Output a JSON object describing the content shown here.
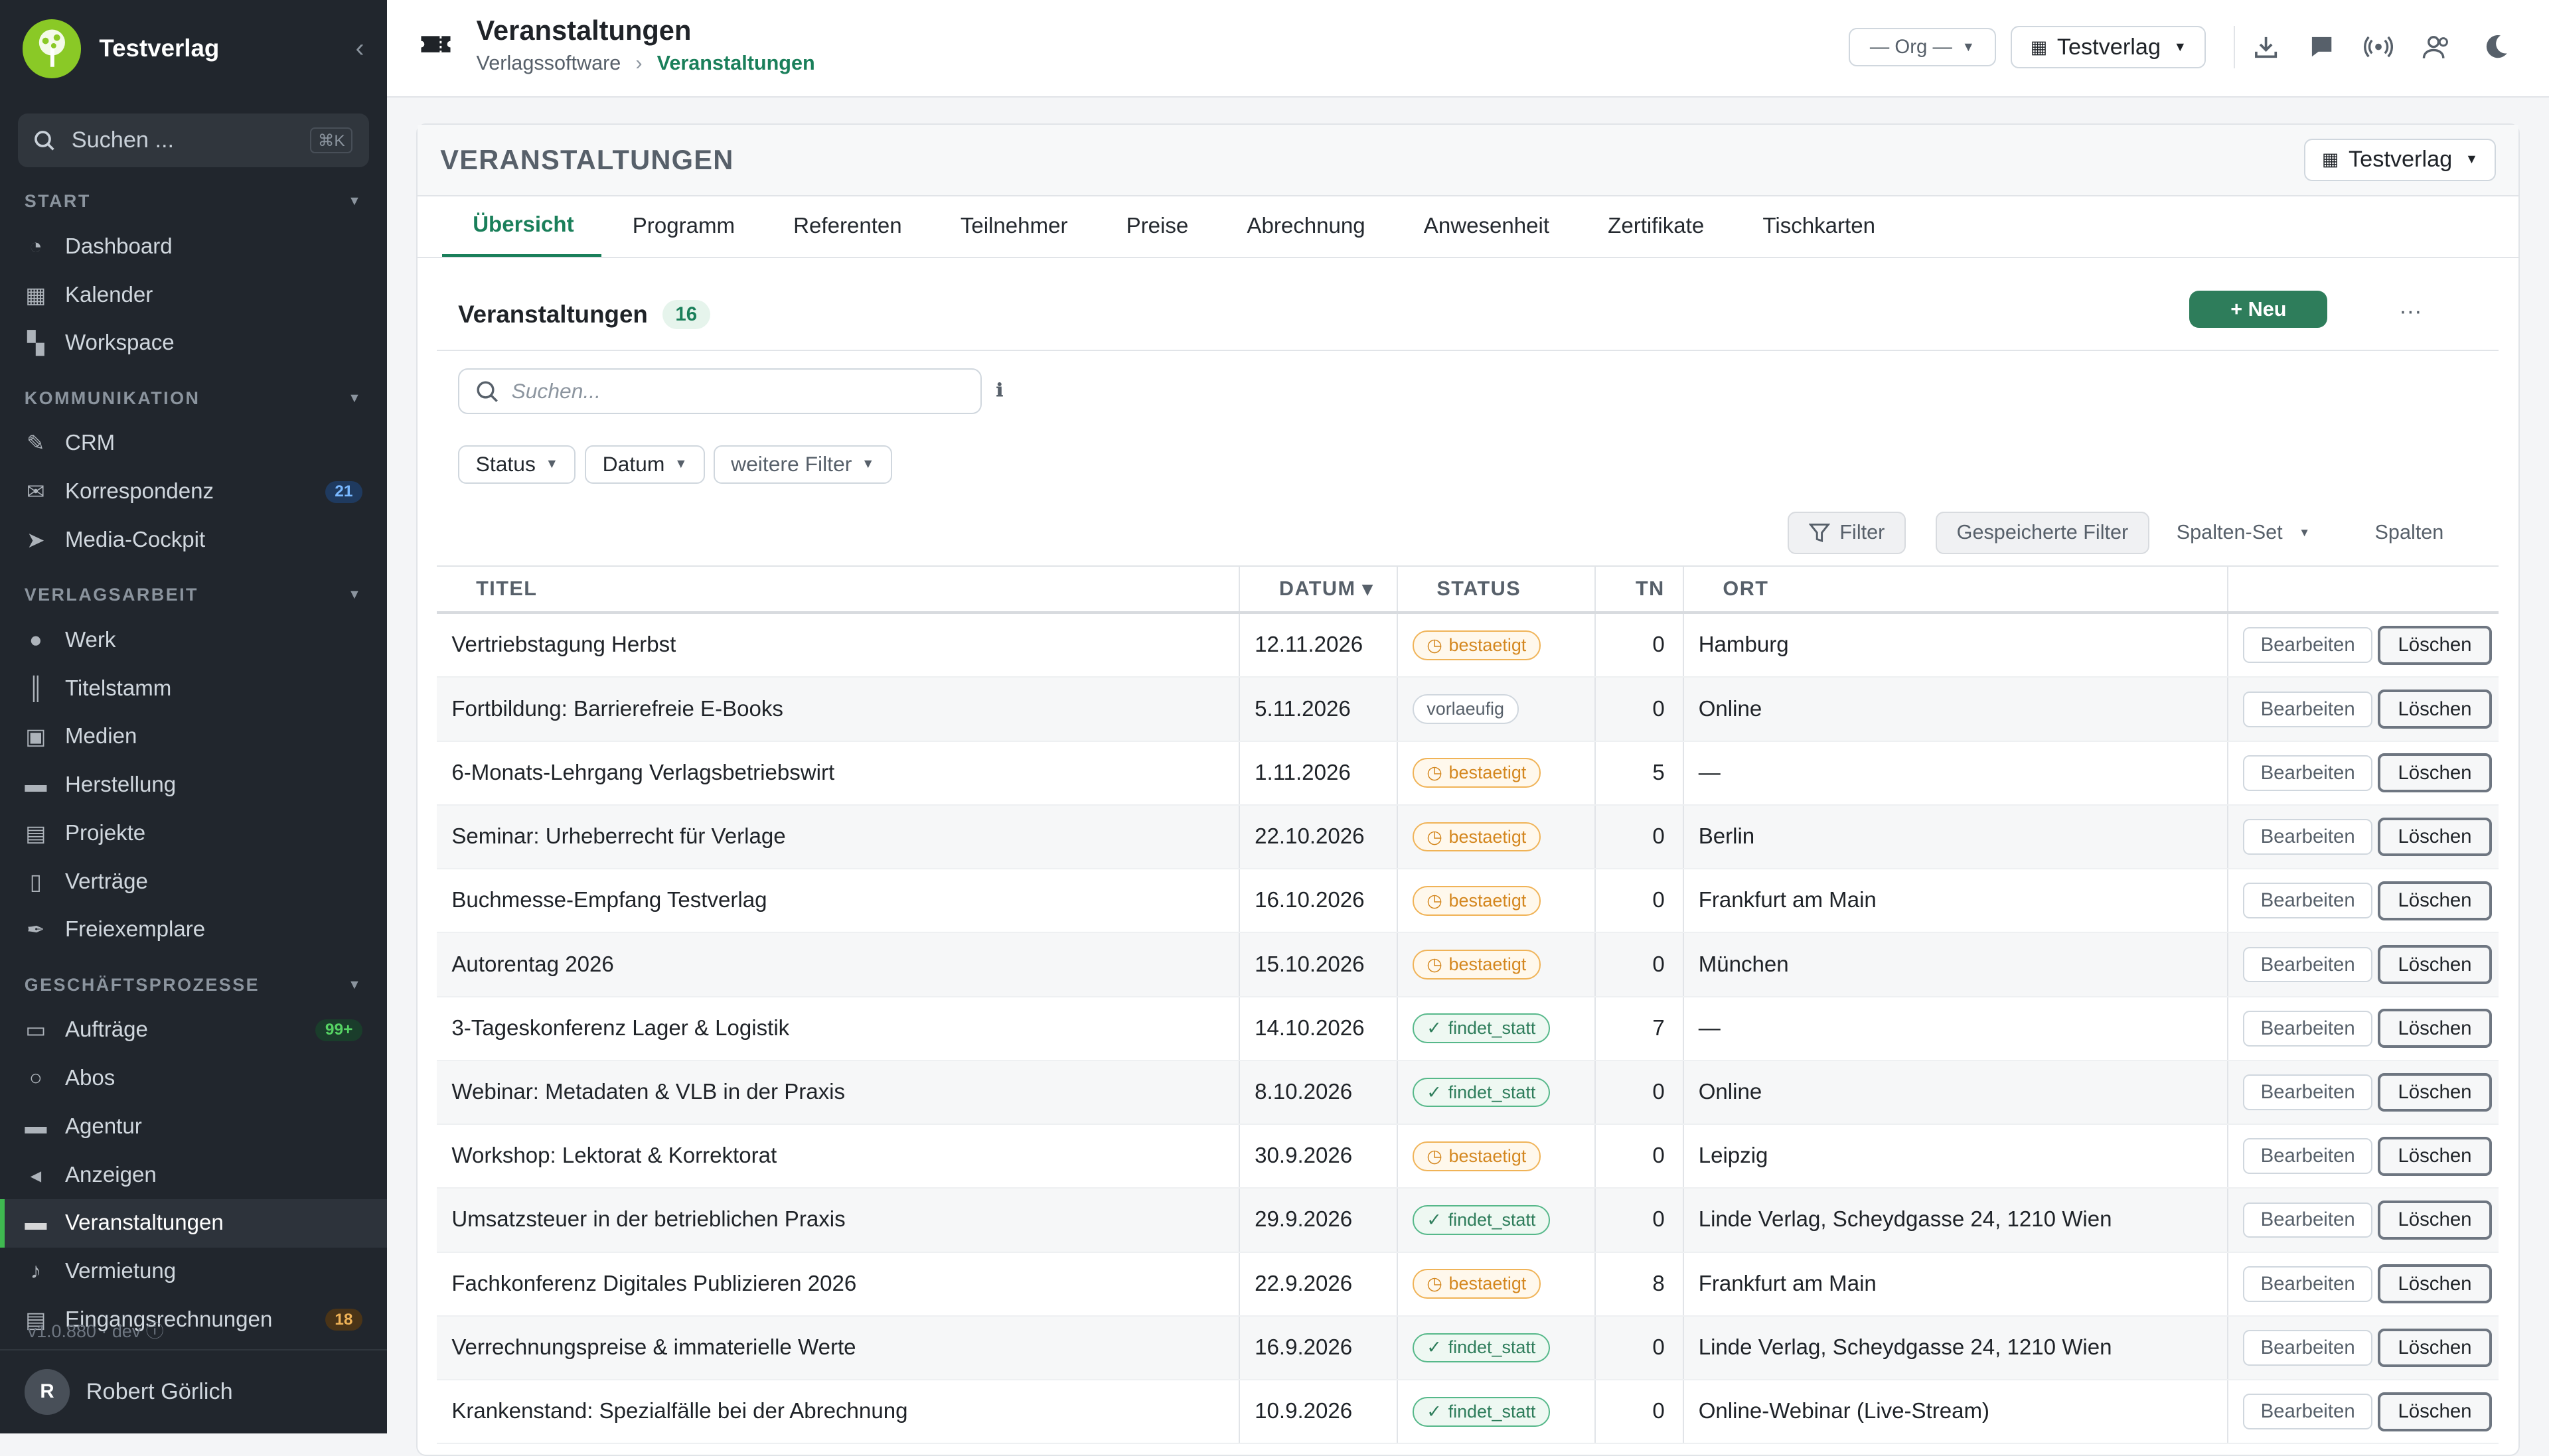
{
  "sidebar": {
    "brand": "Testverlag",
    "search_placeholder": "Suchen ...",
    "search_shortcut": "⌘K",
    "sections": [
      {
        "label": "START",
        "items": [
          {
            "label": "Dashboard",
            "icon": "dashboard-icon"
          },
          {
            "label": "Kalender",
            "icon": "calendar-icon"
          },
          {
            "label": "Workspace",
            "icon": "workspace-icon"
          }
        ]
      },
      {
        "label": "KOMMUNIKATION",
        "items": [
          {
            "label": "CRM",
            "icon": "crm-icon"
          },
          {
            "label": "Korrespondenz",
            "icon": "mail-icon",
            "badge": "21"
          },
          {
            "label": "Media-Cockpit",
            "icon": "send-icon"
          }
        ]
      },
      {
        "label": "VERLAGSARBEIT",
        "items": [
          {
            "label": "Werk",
            "icon": "bulb-icon"
          },
          {
            "label": "Titelstamm",
            "icon": "books-icon"
          },
          {
            "label": "Medien",
            "icon": "image-icon"
          },
          {
            "label": "Herstellung",
            "icon": "briefcase-icon"
          },
          {
            "label": "Projekte",
            "icon": "project-icon"
          },
          {
            "label": "Verträge",
            "icon": "contract-icon"
          },
          {
            "label": "Freiexemplare",
            "icon": "feather-icon"
          }
        ]
      },
      {
        "label": "GESCHÄFTSPROZESSE",
        "items": [
          {
            "label": "Aufträge",
            "icon": "orders-icon",
            "badge": "99+"
          },
          {
            "label": "Abos",
            "icon": "subscription-icon"
          },
          {
            "label": "Agentur",
            "icon": "agency-icon"
          },
          {
            "label": "Anzeigen",
            "icon": "megaphone-icon"
          },
          {
            "label": "Veranstaltungen",
            "icon": "ticket-icon"
          },
          {
            "label": "Vermietung",
            "icon": "note-icon"
          },
          {
            "label": "Eingangsrechnungen",
            "icon": "invoice-icon",
            "badge": "18"
          }
        ]
      }
    ],
    "version": "v1.0.880 · dev",
    "user": {
      "initial": "R",
      "name": "Robert Görlich"
    }
  },
  "header": {
    "title": "Veranstaltungen",
    "breadcrumb": [
      "Verlagssoftware",
      "Veranstaltungen"
    ],
    "org_select": "— Org —",
    "verlag_select": "Testverlag"
  },
  "card": {
    "title": "VERANSTALTUNGEN",
    "verlag_select": "Testverlag",
    "tabs": [
      "Übersicht",
      "Programm",
      "Referenten",
      "Teilnehmer",
      "Preise",
      "Abrechnung",
      "Anwesenheit",
      "Zertifikate",
      "Tischkarten"
    ],
    "list_title": "Veranstaltungen",
    "count": "16",
    "new_button": "+ Neu",
    "more": "···",
    "search_placeholder": "Suchen...",
    "info": "ℹ",
    "filters": [
      "Status",
      "Datum",
      "weitere Filter"
    ],
    "tools": {
      "filter": "Filter",
      "saved": "Gespeicherte Filter",
      "column_set": "Spalten-Set",
      "columns": "Spalten"
    }
  },
  "table": {
    "columns": [
      "TITEL",
      "DATUM ▾",
      "STATUS",
      "TN",
      "ORT"
    ],
    "edit_label": "Bearbeiten",
    "delete_label": "Löschen",
    "rows": [
      {
        "title": "Vertriebstagung Herbst",
        "date": "12.11.2026",
        "status": "bestaetigt",
        "tn": "0",
        "ort": "Hamburg"
      },
      {
        "title": "Fortbildung: Barrierefreie E-Books",
        "date": "5.11.2026",
        "status": "vorlaeufig",
        "tn": "0",
        "ort": "Online"
      },
      {
        "title": "6-Monats-Lehrgang Verlagsbetriebswirt",
        "date": "1.11.2026",
        "status": "bestaetigt",
        "tn": "5",
        "ort": "—"
      },
      {
        "title": "Seminar: Urheberrecht für Verlage",
        "date": "22.10.2026",
        "status": "bestaetigt",
        "tn": "0",
        "ort": "Berlin"
      },
      {
        "title": "Buchmesse-Empfang Testverlag",
        "date": "16.10.2026",
        "status": "bestaetigt",
        "tn": "0",
        "ort": "Frankfurt am Main"
      },
      {
        "title": "Autorentag 2026",
        "date": "15.10.2026",
        "status": "bestaetigt",
        "tn": "0",
        "ort": "München"
      },
      {
        "title": "3-Tageskonferenz Lager & Logistik",
        "date": "14.10.2026",
        "status": "findet_statt",
        "tn": "7",
        "ort": "—"
      },
      {
        "title": "Webinar: Metadaten & VLB in der Praxis",
        "date": "8.10.2026",
        "status": "findet_statt",
        "tn": "0",
        "ort": "Online"
      },
      {
        "title": "Workshop: Lektorat & Korrektorat",
        "date": "30.9.2026",
        "status": "bestaetigt",
        "tn": "0",
        "ort": "Leipzig"
      },
      {
        "title": "Umsatzsteuer in der betrieblichen Praxis",
        "date": "29.9.2026",
        "status": "findet_statt",
        "tn": "0",
        "ort": "Linde Verlag, Scheydgasse 24, 1210 Wien"
      },
      {
        "title": "Fachkonferenz Digitales Publizieren 2026",
        "date": "22.9.2026",
        "status": "bestaetigt",
        "tn": "8",
        "ort": "Frankfurt am Main"
      },
      {
        "title": "Verrechnungspreise & immaterielle Werte",
        "date": "16.9.2026",
        "status": "findet_statt",
        "tn": "0",
        "ort": "Linde Verlag, Scheydgasse 24, 1210 Wien"
      },
      {
        "title": "Krankenstand: Spezialfälle bei der Abrechnung",
        "date": "10.9.2026",
        "status": "findet_statt",
        "tn": "0",
        "ort": "Online-Webinar (Live-Stream)"
      }
    ]
  },
  "colors": {
    "accent": "#1a7f5a",
    "sidebar_bg": "#21262d",
    "logo": "#8ac926",
    "status_orange": "#d4871f",
    "status_green": "#2e7d5b"
  }
}
